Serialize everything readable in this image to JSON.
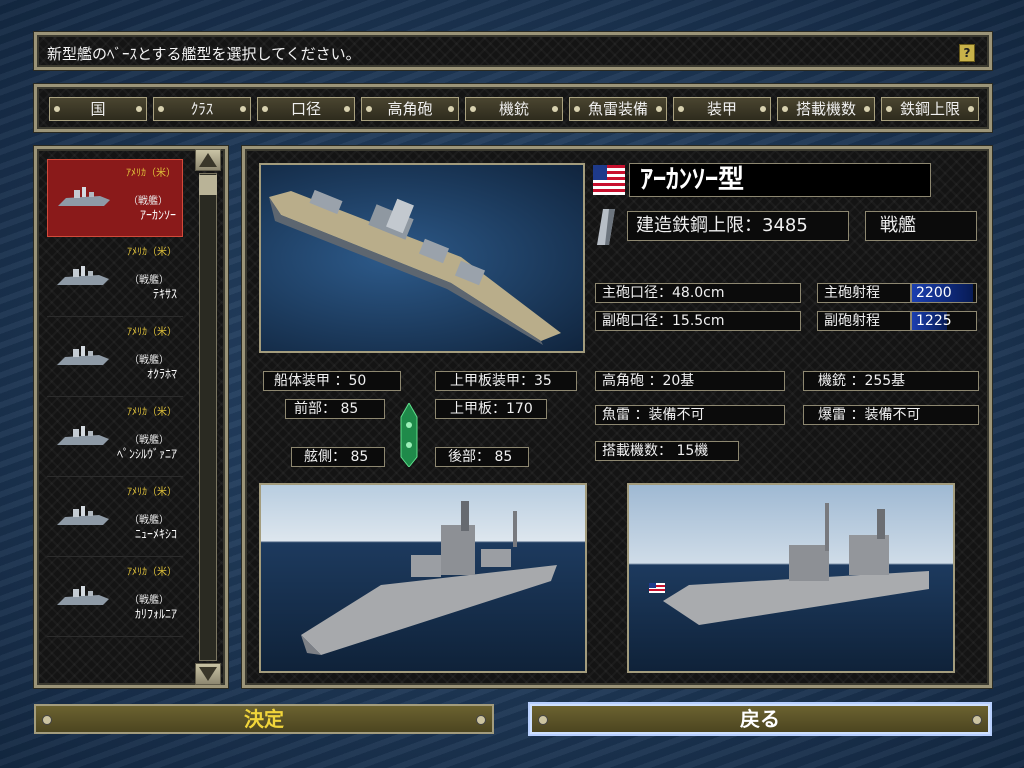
{
  "header": {
    "message": "新型艦のﾍﾞｰｽとする艦型を選択してください。",
    "help_label": "?"
  },
  "tabs": [
    {
      "label": "国"
    },
    {
      "label": "ｸﾗｽ"
    },
    {
      "label": "口径"
    },
    {
      "label": "高角砲"
    },
    {
      "label": "機銃"
    },
    {
      "label": "魚雷装備"
    },
    {
      "label": "装甲"
    },
    {
      "label": "搭載機数"
    },
    {
      "label": "鉄鋼上限"
    }
  ],
  "ship_list": [
    {
      "nation": "ｱﾒﾘｶ（米）",
      "class": "（戦艦）",
      "name": "ｱｰｶﾝｿｰ",
      "selected": true
    },
    {
      "nation": "ｱﾒﾘｶ（米）",
      "class": "（戦艦）",
      "name": "ﾃｷｻｽ",
      "selected": false
    },
    {
      "nation": "ｱﾒﾘｶ（米）",
      "class": "（戦艦）",
      "name": "ｵｸﾗﾎﾏ",
      "selected": false
    },
    {
      "nation": "ｱﾒﾘｶ（米）",
      "class": "（戦艦）",
      "name": "ﾍﾟﾝｼﾙｳﾞｧﾆｱ",
      "selected": false
    },
    {
      "nation": "ｱﾒﾘｶ（米）",
      "class": "（戦艦）",
      "name": "ﾆｭｰﾒｷｼｺ",
      "selected": false
    },
    {
      "nation": "ｱﾒﾘｶ（米）",
      "class": "（戦艦）",
      "name": "ｶﾘﾌｫﾙﾆｱ",
      "selected": false
    }
  ],
  "detail": {
    "ship_name": "ｱｰｶﾝｿｰ型",
    "steel_limit": "建造鉄鋼上限：3485",
    "ship_type": "戦艦",
    "main_caliber": "主砲口径：48.0cm",
    "main_range_label": "主砲射程",
    "main_range_value": "2200",
    "main_range_fill": 0.95,
    "sub_caliber": "副砲口径：15.5cm",
    "sub_range_label": "副砲射程",
    "sub_range_value": "1225",
    "sub_range_fill": 0.55,
    "hull_armor": "船体装甲 ：50",
    "deck_armor": "上甲板装甲：35",
    "bow_armor": "前部： 85",
    "upper_deck": "上甲板：170",
    "side_armor": "舷側： 85",
    "stern_armor": "後部： 85",
    "aa_guns": "高角砲  ：20基",
    "machine_guns": "機銃  ：255基",
    "torpedo": "魚雷  ：装備不可",
    "depth_charge": "爆雷  ：装備不可",
    "aircraft": "搭載機数： 15機"
  },
  "buttons": {
    "confirm": "決定",
    "back": "戻る"
  },
  "colors": {
    "gold_text": "#f1d53a",
    "selected_row": "#8a1a1a",
    "range_bar": "#1b3fb0"
  }
}
